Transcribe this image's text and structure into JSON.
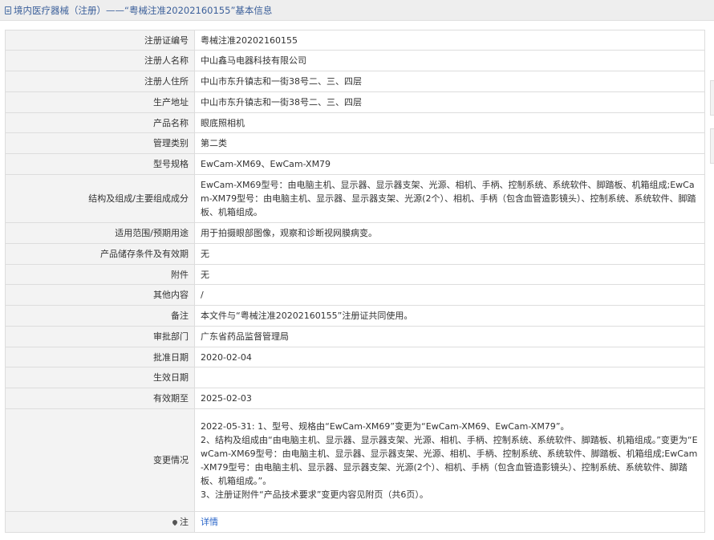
{
  "header": {
    "title": "境内医疗器械（注册）——“粤械注准20202160155”基本信息"
  },
  "rows": [
    {
      "label": "注册证编号",
      "value": "粤械注准20202160155"
    },
    {
      "label": "注册人名称",
      "value": "中山鑫马电器科技有限公司"
    },
    {
      "label": "注册人住所",
      "value": "中山市东升镇志和一街38号二、三、四层"
    },
    {
      "label": "生产地址",
      "value": "中山市东升镇志和一街38号二、三、四层"
    },
    {
      "label": "产品名称",
      "value": "眼底照相机"
    },
    {
      "label": "管理类别",
      "value": "第二类"
    },
    {
      "label": "型号规格",
      "value": "EwCam-XM69、EwCam-XM79"
    },
    {
      "label": "结构及组成/主要组成成分",
      "value": "EwCam-XM69型号：由电脑主机、显示器、显示器支架、光源、相机、手柄、控制系统、系统软件、脚踏板、机箱组成;EwCam-XM79型号：由电脑主机、显示器、显示器支架、光源(2个）、相机、手柄（包含血管造影镜头）、控制系统、系统软件、脚踏板、机箱组成。"
    },
    {
      "label": "适用范围/预期用途",
      "value": "用于拍摄眼部图像，观察和诊断视网膜病变。"
    },
    {
      "label": "产品储存条件及有效期",
      "value": "无"
    },
    {
      "label": "附件",
      "value": "无"
    },
    {
      "label": "其他内容",
      "value": "/"
    },
    {
      "label": "备注",
      "value": "本文件与“粤械注准20202160155”注册证共同使用。"
    },
    {
      "label": "审批部门",
      "value": "广东省药品监督管理局"
    },
    {
      "label": "批准日期",
      "value": "2020-02-04"
    },
    {
      "label": "生效日期",
      "value": ""
    },
    {
      "label": "有效期至",
      "value": "2025-02-03"
    }
  ],
  "change": {
    "label": "变更情况",
    "lines": [
      "2022-05-31: 1、型号、规格由“EwCam-XM69”变更为“EwCam-XM69、EwCam-XM79”。",
      "2、结构及组成由“由电脑主机、显示器、显示器支架、光源、相机、手柄、控制系统、系统软件、脚踏板、机箱组成。”变更为“EwCam-XM69型号：由电脑主机、显示器、显示器支架、光源、相机、手柄、控制系统、系统软件、脚踏板、机箱组成;EwCam-XM79型号：由电脑主机、显示器、显示器支架、光源(2个）、相机、手柄（包含血管造影镜头）、控制系统、系统软件、脚踏板、机箱组成。”。",
      "3、注册证附件“产品技术要求”变更内容见附页（共6页）。"
    ]
  },
  "note": {
    "label": "注",
    "icon": "map-pin-icon",
    "link_text": "详情"
  },
  "colors": {
    "title_text": "#3b5f9a",
    "label_bg": "#f3f3f3",
    "border": "#dddddd",
    "link": "#2a66c9"
  }
}
